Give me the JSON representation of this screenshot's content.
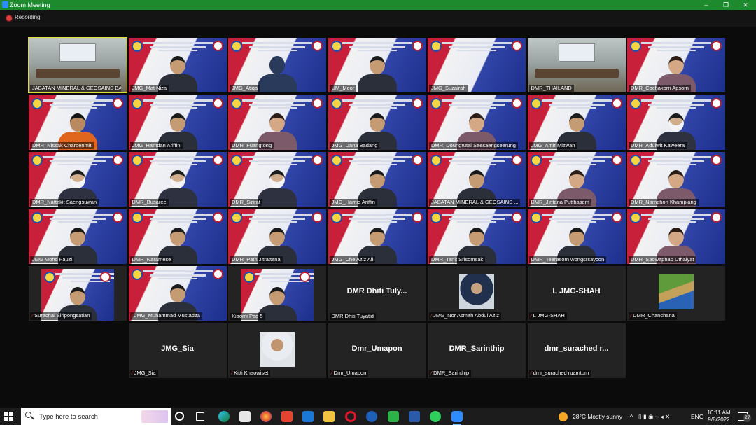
{
  "window": {
    "title": "Zoom Meeting",
    "min": "–",
    "max": "❐",
    "close": "✕"
  },
  "recording": {
    "label": "Recording"
  },
  "tiles": [
    {
      "label": "JABATAN MINERAL & GEOSAINS BA...",
      "bg": "room",
      "active": true
    },
    {
      "label": "JMG_Mat Niza",
      "bg": "banner",
      "person": "man"
    },
    {
      "label": "JMG_Atiqa",
      "bg": "banner",
      "person": "hijab"
    },
    {
      "label": "UM_Meor",
      "bg": "banner",
      "person": "man"
    },
    {
      "label": "JMG_Suzairah",
      "bg": "banner",
      "person": "none"
    },
    {
      "label": "DMR_THAILAND",
      "bg": "room"
    },
    {
      "label": "DMR_Cochakorn Apsorn",
      "bg": "banner",
      "person": "woman"
    },
    {
      "label": "DMR_Nissak Charoenmit",
      "bg": "banner",
      "person": "orange"
    },
    {
      "label": "JMG_Hamdan Ariffin",
      "bg": "banner",
      "person": "man"
    },
    {
      "label": "DMR_Fuangtong",
      "bg": "banner",
      "person": "woman"
    },
    {
      "label": "JMG_Dana Badang",
      "bg": "banner",
      "person": "man"
    },
    {
      "label": "DMR_Doungrutai Saesaengseerung",
      "bg": "banner",
      "person": "woman"
    },
    {
      "label": "JMG_Amir Mizwan",
      "bg": "banner",
      "person": "man"
    },
    {
      "label": "DMR_Adulwit Kaweera",
      "bg": "banner",
      "person": "mask"
    },
    {
      "label": "DMR_Nattakit Saengsuwan",
      "bg": "banner",
      "person": "mask"
    },
    {
      "label": "DMR_Busaree",
      "bg": "banner",
      "person": "mask"
    },
    {
      "label": "DMR_Sirirat",
      "bg": "banner",
      "person": "mask"
    },
    {
      "label": "JMG_Hamid Ariffin",
      "bg": "banner",
      "person": "man"
    },
    {
      "label": "JABATAN MINERAL & GEOSAINS ...",
      "bg": "banner",
      "person": "man"
    },
    {
      "label": "DMR_Jintana Putthasem",
      "bg": "banner",
      "person": "woman"
    },
    {
      "label": "DMR_Namphon Khamplang",
      "bg": "banner",
      "person": "woman"
    },
    {
      "label": "JMG Mohd Fauzi",
      "bg": "banner",
      "person": "man"
    },
    {
      "label": "DMR_Naramese",
      "bg": "banner",
      "person": "man"
    },
    {
      "label": "DMR_Path Jitrattana",
      "bg": "banner",
      "person": "man"
    },
    {
      "label": "JMG_Che Aziz Ali",
      "bg": "banner",
      "person": "man"
    },
    {
      "label": "DMR_Tanit Srisomsak",
      "bg": "banner",
      "person": "man"
    },
    {
      "label": "DMR_Teerasorn wongsrsaycon",
      "bg": "banner",
      "person": "man"
    },
    {
      "label": "DMR_Saowaphap Uthaiyat",
      "bg": "banner",
      "person": "woman"
    },
    {
      "label": "Surachai Siripongsatian",
      "bg": "framed",
      "muted": true,
      "person": "man"
    },
    {
      "label": "JMG_Muhammad Mustadza",
      "bg": "banner",
      "muted": true,
      "person": "man"
    },
    {
      "label": "Xiaomi Pad 5",
      "bg": "framed",
      "person": "man"
    },
    {
      "label": "DMR Dhiti Tuyatid",
      "bg": "dark",
      "big": "DMR Dhiti Tuly..."
    },
    {
      "label": "JMG_Nor Asmah Abdul Aziz",
      "bg": "dark",
      "muted": true,
      "photo": "hijab"
    },
    {
      "label": "L JMG-SHAH",
      "bg": "dark",
      "muted": true,
      "big": "L JMG-SHAH"
    },
    {
      "label": "DMR_Chanchana",
      "bg": "dark",
      "muted": true,
      "photo": "outdoor"
    },
    {
      "label": "JMG_Sia",
      "bg": "dark",
      "muted": true,
      "big": "JMG_Sia"
    },
    {
      "label": "Kitti Khaowiset",
      "bg": "dark",
      "muted": true,
      "photo": "man"
    },
    {
      "label": "Dmr_Umapon",
      "bg": "dark",
      "muted": true,
      "big": "Dmr_Umapon"
    },
    {
      "label": "DMR_Sarinthip",
      "bg": "dark",
      "muted": true,
      "big": "DMR_Sarinthip"
    },
    {
      "label": "dmr_surached ruamtum",
      "bg": "dark",
      "muted": true,
      "big": "dmr_surached r..."
    }
  ],
  "taskbar": {
    "search_placeholder": "Type here to search",
    "weather": "28°C  Mostly sunny",
    "lang": "ENG",
    "time": "10:11 AM",
    "date": "9/8/2022",
    "notif_count": "27"
  }
}
